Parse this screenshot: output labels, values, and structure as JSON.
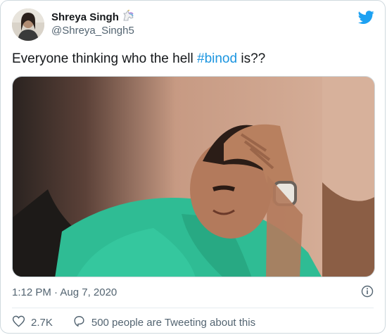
{
  "author": {
    "name": "Shreya Singh",
    "handle": "@Shreya_Singh5",
    "badge_icon": "unicorn-icon",
    "avatar": "profile-avatar"
  },
  "tweet": {
    "text_before": "Everyone thinking who the hell ",
    "hashtag": "#binod",
    "text_after": " is??",
    "timestamp": "1:12 PM · Aug 7, 2020"
  },
  "media": {
    "description_icon": "meme-photo"
  },
  "actions": {
    "likes_count": "2.7K",
    "tweeting_text": "500 people are Tweeting about this"
  },
  "colors": {
    "twitter_blue": "#1da1f2",
    "hashtag": "#1b95e0",
    "secondary_text": "#536471",
    "like_heart": "#536471"
  }
}
